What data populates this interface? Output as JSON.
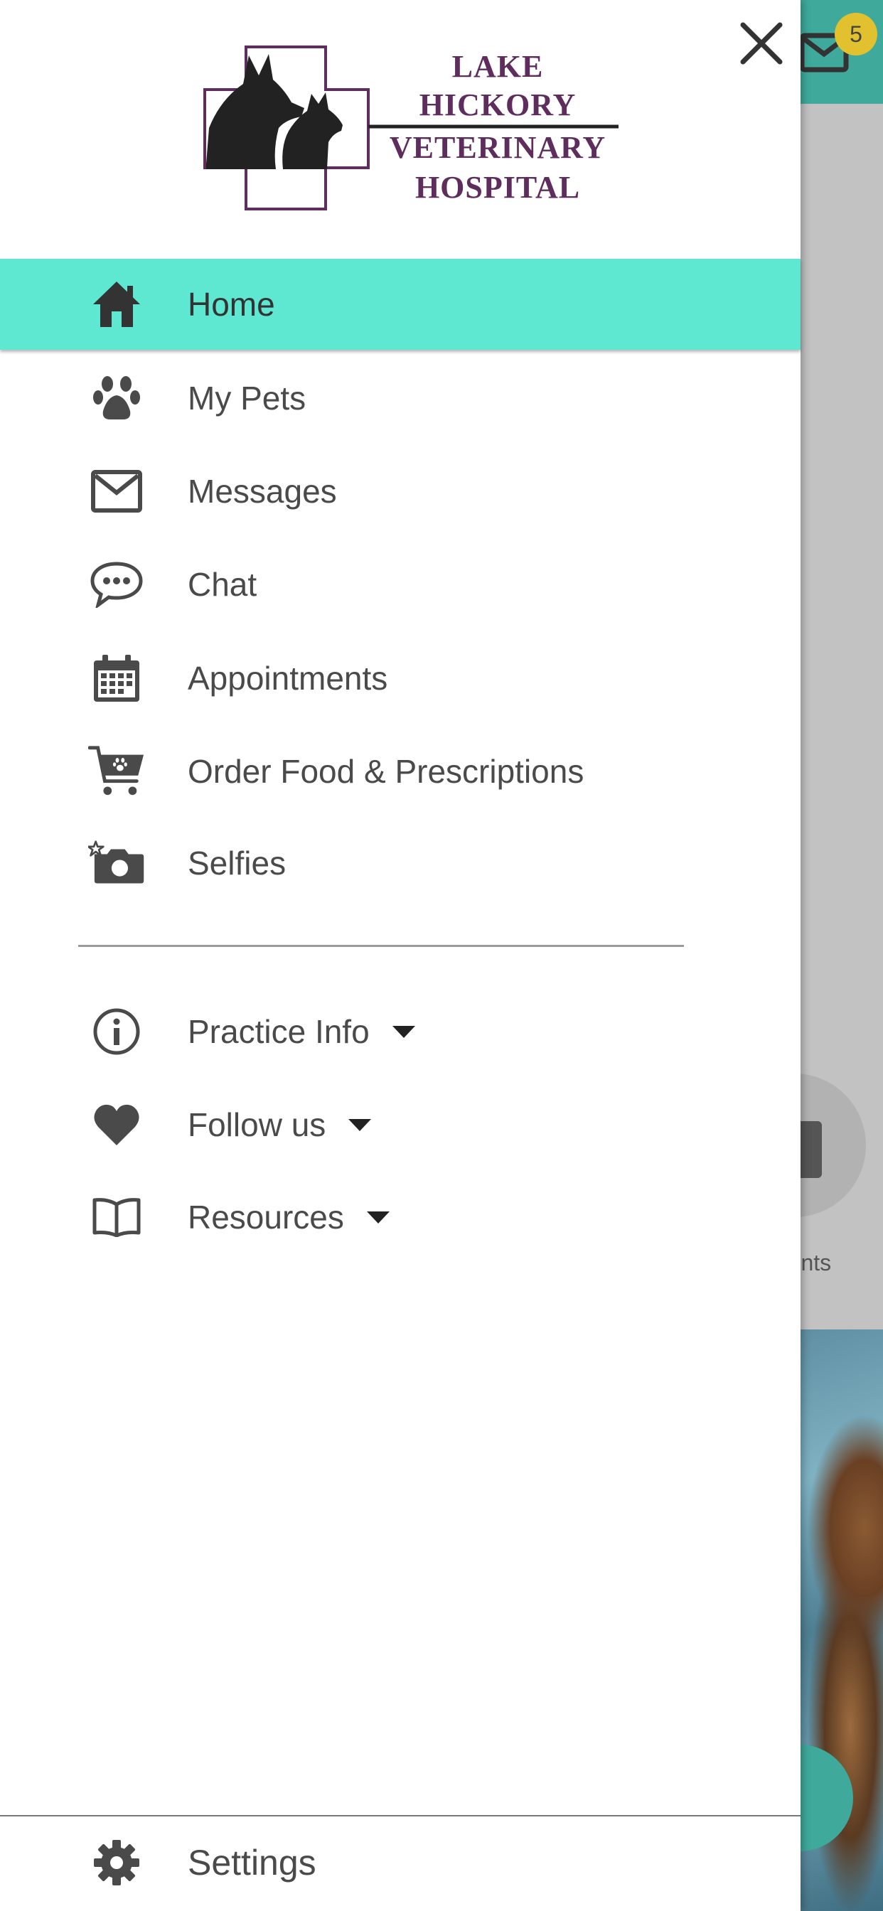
{
  "colors": {
    "accent_teal": "#5ee8d2",
    "header_teal": "#3fa99b",
    "badge_yellow": "#e2c12f",
    "logo_purple": "#5e2d5e",
    "icon_gray": "#4a4a4a"
  },
  "background": {
    "badge_count": "5",
    "appointments_partial_label": "ments"
  },
  "logo": {
    "line1": "LAKE",
    "line2": "HICKORY",
    "line3": "VETERINARY",
    "line4": "HOSPITAL"
  },
  "menu": {
    "primary": [
      {
        "label": "Home",
        "icon": "home-icon",
        "active": true
      },
      {
        "label": "My Pets",
        "icon": "paw-icon"
      },
      {
        "label": "Messages",
        "icon": "mail-icon"
      },
      {
        "label": "Chat",
        "icon": "chat-bubble-icon"
      },
      {
        "label": "Appointments",
        "icon": "calendar-icon"
      },
      {
        "label": "Order Food & Prescriptions",
        "icon": "cart-icon"
      },
      {
        "label": "Selfies",
        "icon": "camera-icon"
      }
    ],
    "secondary": [
      {
        "label": "Practice Info",
        "icon": "info-icon"
      },
      {
        "label": "Follow us",
        "icon": "heart-icon"
      },
      {
        "label": "Resources",
        "icon": "book-icon"
      }
    ],
    "settings": {
      "label": "Settings",
      "icon": "gear-icon"
    }
  }
}
